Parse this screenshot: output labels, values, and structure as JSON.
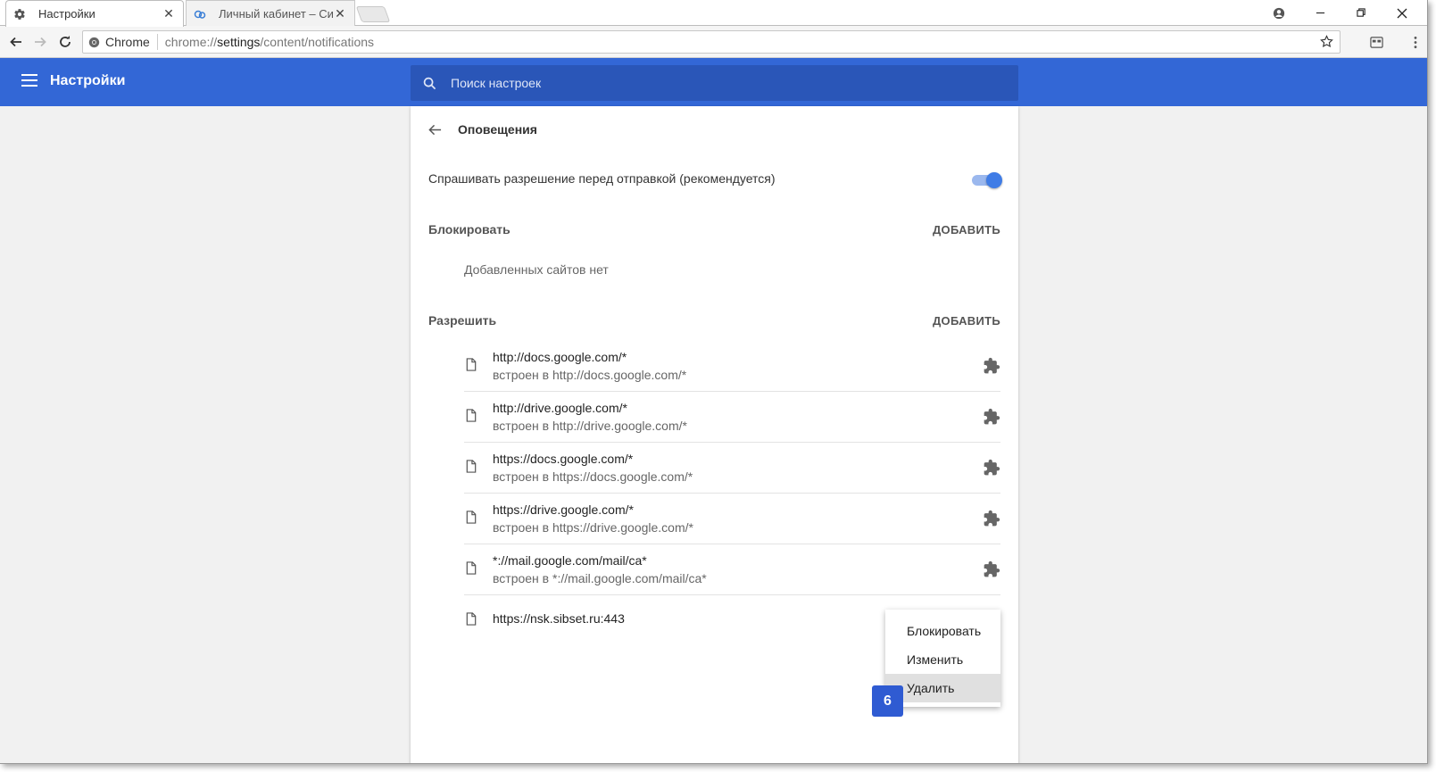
{
  "browser": {
    "tabs": [
      {
        "title": "Настройки",
        "icon": "gear-icon"
      },
      {
        "title": "Личный кабинет – Сибирские Сети",
        "icon": "sibset-icon"
      }
    ],
    "omnibox": {
      "chip": "Chrome",
      "url_prefix": "chrome://",
      "url_host": "settings",
      "url_path": "/content/notifications"
    }
  },
  "header": {
    "title": "Настройки",
    "search_placeholder": "Поиск настроек"
  },
  "page": {
    "title": "Оповещения",
    "ask_label": "Спрашивать разрешение перед отправкой (рекомендуется)",
    "ask_enabled": true,
    "block": {
      "label": "Блокировать",
      "add_label": "ДОБАВИТЬ",
      "empty_text": "Добавленных сайтов нет"
    },
    "allow": {
      "label": "Разрешить",
      "add_label": "ДОБАВИТЬ",
      "sites": [
        {
          "url": "http://docs.google.com/*",
          "sub": "встроен в http://docs.google.com/*"
        },
        {
          "url": "http://drive.google.com/*",
          "sub": "встроен в http://drive.google.com/*"
        },
        {
          "url": "https://docs.google.com/*",
          "sub": "встроен в https://docs.google.com/*"
        },
        {
          "url": "https://drive.google.com/*",
          "sub": "встроен в https://drive.google.com/*"
        },
        {
          "url": "*://mail.google.com/mail/ca*",
          "sub": "встроен в *://mail.google.com/mail/ca*"
        },
        {
          "url": "https://nsk.sibset.ru:443",
          "sub": ""
        }
      ]
    }
  },
  "context_menu": {
    "items": [
      "Блокировать",
      "Изменить",
      "Удалить"
    ],
    "highlighted": "Удалить"
  },
  "step_badge": "6",
  "colors": {
    "header_blue": "#3367d6",
    "search_blue": "#2a56b8",
    "toggle_on": "#3f7ce6",
    "badge_blue": "#2f5bd2"
  }
}
